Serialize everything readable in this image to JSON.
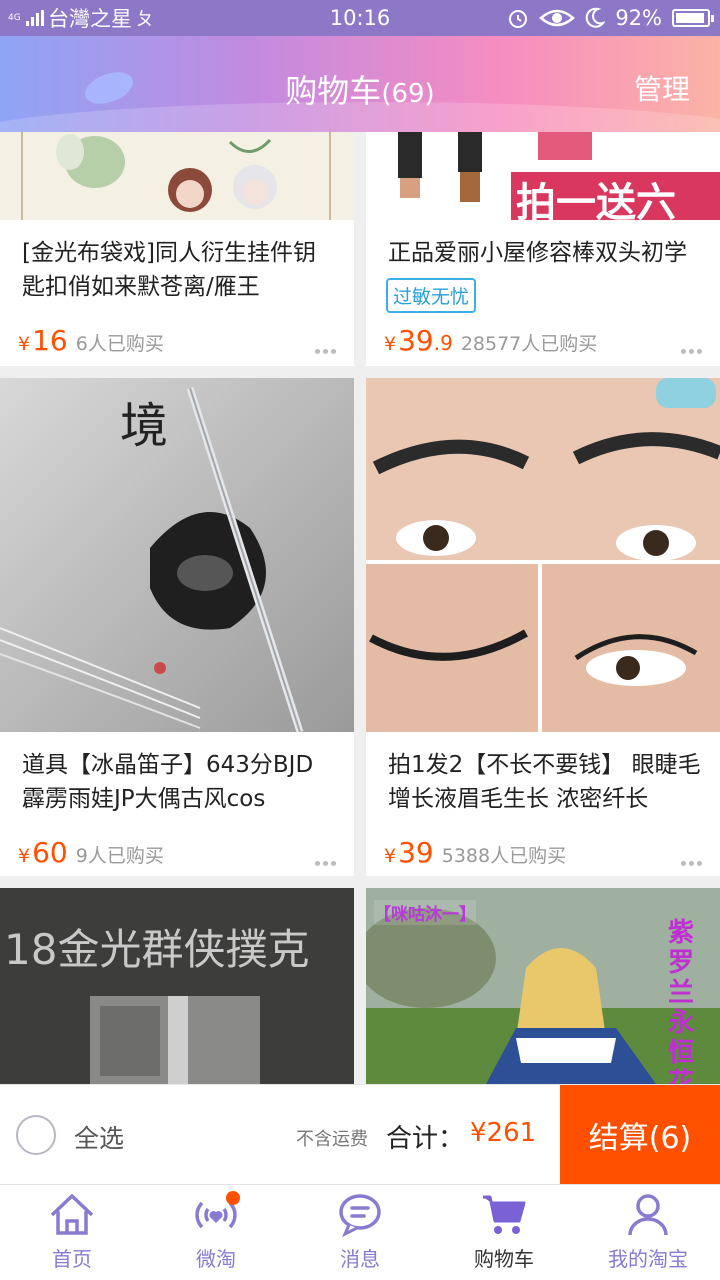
{
  "status_bar": {
    "network": "4G",
    "carrier": "台灣之星",
    "time": "10:16",
    "battery": "92%",
    "battery_level": 0.92
  },
  "header": {
    "title": "购物车",
    "count": "(69)",
    "manage": "管理"
  },
  "products": [
    {
      "title": "[金光布袋戏]同人衍生挂件钥匙扣俏如来默苍离/雁王",
      "currency": "¥",
      "price": "16",
      "price_decimal": "",
      "sold": "6人已购买"
    },
    {
      "title": "正品爱丽小屋修容棒双头初学",
      "tag": "过敏无忧",
      "banner_text": "拍一送六",
      "currency": "¥",
      "price": "39",
      "price_decimal": ".9",
      "sold": "28577人已购买"
    },
    {
      "title": "道具【冰晶笛子】643分BJD霹雳雨娃JP大偶古风cos",
      "image_text": "境",
      "currency": "¥",
      "price": "60",
      "price_decimal": "",
      "sold": "9人已购买"
    },
    {
      "title": "拍1发2【不长不要钱】 眼睫毛增长液眉毛生长 浓密纤长",
      "currency": "¥",
      "price": "39",
      "price_decimal": "",
      "sold": "5388人已购买"
    },
    {
      "image_text": "18金光群侠撲克"
    },
    {
      "image_text": "【咪咕沐一】",
      "image_text_2": "紫罗兰永恒花园"
    }
  ],
  "bottom_bar": {
    "select_all": "全选",
    "no_shipping": "不含运费",
    "total_label": "合计：",
    "total_value": "¥261",
    "checkout": "结算(6)"
  },
  "tabs": [
    {
      "label": "首页",
      "icon": "home-icon"
    },
    {
      "label": "微淘",
      "icon": "weitao-icon"
    },
    {
      "label": "消息",
      "icon": "message-icon"
    },
    {
      "label": "购物车",
      "icon": "cart-icon",
      "active": true
    },
    {
      "label": "我的淘宝",
      "icon": "profile-icon"
    }
  ],
  "colors": {
    "accent": "#ff5000",
    "tab_icon": "#8a7ad0",
    "status_bar": "#8d78c8"
  }
}
